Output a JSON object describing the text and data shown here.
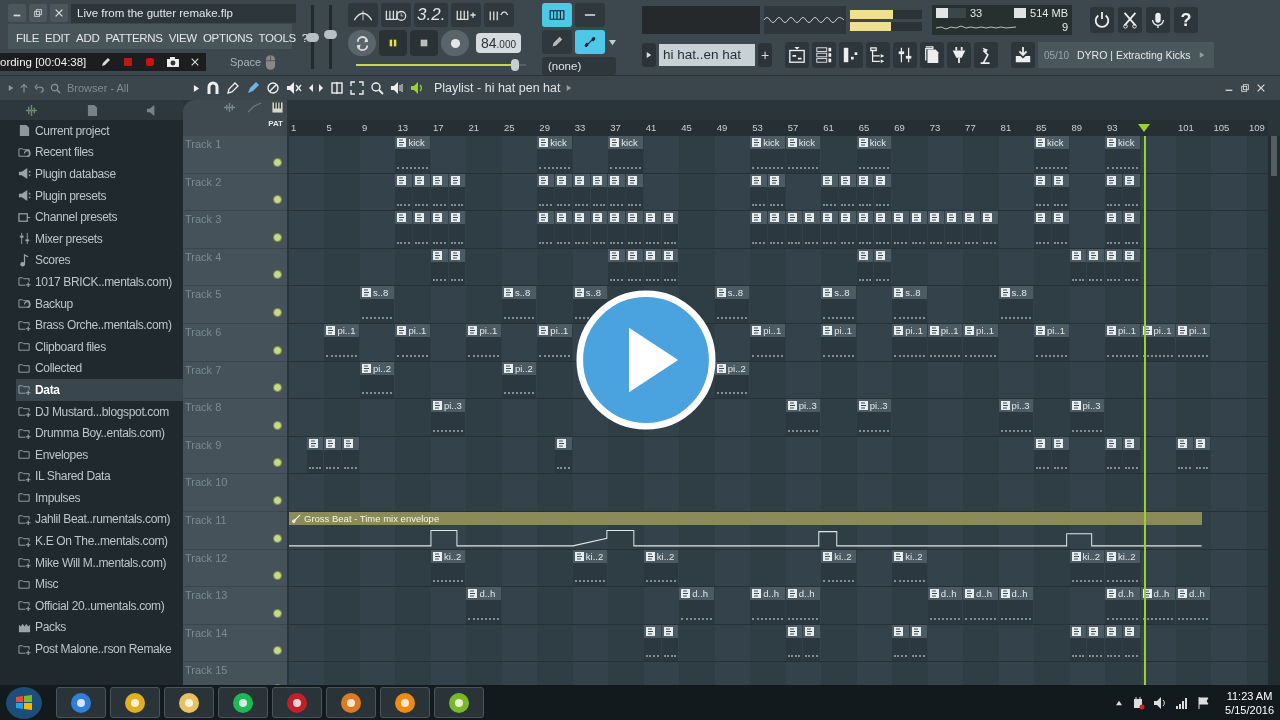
{
  "window": {
    "title": "Live from the gutter remake.flp"
  },
  "menu": [
    "FILE",
    "EDIT",
    "ADD",
    "PATTERNS",
    "VIEW",
    "OPTIONS",
    "TOOLS",
    "?"
  ],
  "recorder": {
    "label": "ording [00:04:38]"
  },
  "hint_key": "Space",
  "mixer_sliders": [
    {
      "level": 0.5
    },
    {
      "level": 0.55
    }
  ],
  "transport": {
    "time_mode": "3.2.",
    "tempo": "84",
    "tempo_fraction": ".000",
    "pitch": {
      "level": 0.96
    },
    "snap": "(none)"
  },
  "meters": [
    {
      "level": 0.6
    },
    {
      "level": 0.57
    }
  ],
  "performance": {
    "cpu": "33",
    "cpu_bar": {
      "level": 0.4
    },
    "ram": "514 MB",
    "polyphony": "9"
  },
  "help_button": "?",
  "pattern_selector": {
    "value": "hi hat..en hat",
    "add": "+"
  },
  "hint_bar": {
    "counter": "05/10",
    "text": "DYRO | Extracting Kicks"
  },
  "browser": {
    "title": "Browser - All",
    "items": [
      {
        "label": "Current project",
        "kind": "project",
        "selected": false
      },
      {
        "label": "Recent files",
        "kind": "recent",
        "selected": false
      },
      {
        "label": "Plugin database",
        "kind": "plugin",
        "selected": false
      },
      {
        "label": "Plugin presets",
        "kind": "plugin",
        "selected": false
      },
      {
        "label": "Channel presets",
        "kind": "channel",
        "selected": false
      },
      {
        "label": "Mixer presets",
        "kind": "mixer",
        "selected": false
      },
      {
        "label": "Scores",
        "kind": "score",
        "selected": false
      },
      {
        "label": "1017 BRICK..mentals.com)",
        "kind": "linked",
        "selected": false
      },
      {
        "label": "Backup",
        "kind": "recent",
        "selected": false
      },
      {
        "label": "Brass Orche..mentals.com)",
        "kind": "linked",
        "selected": false
      },
      {
        "label": "Clipboard files",
        "kind": "folder",
        "selected": false
      },
      {
        "label": "Collected",
        "kind": "folder",
        "selected": false
      },
      {
        "label": "Data",
        "kind": "linked",
        "selected": true
      },
      {
        "label": "DJ Mustard...blogspot.com",
        "kind": "linked",
        "selected": false
      },
      {
        "label": "Drumma Boy..entals.com)",
        "kind": "linked",
        "selected": false
      },
      {
        "label": "Envelopes",
        "kind": "folder",
        "selected": false
      },
      {
        "label": "IL Shared Data",
        "kind": "linked",
        "selected": false
      },
      {
        "label": "Impulses",
        "kind": "folder",
        "selected": false
      },
      {
        "label": "Jahlil Beat..rumentals.com)",
        "kind": "linked",
        "selected": false
      },
      {
        "label": "K.E On The..mentals.com)",
        "kind": "linked",
        "selected": false
      },
      {
        "label": "Mike Will M..mentals.com)",
        "kind": "linked",
        "selected": false
      },
      {
        "label": "Misc",
        "kind": "folder",
        "selected": false
      },
      {
        "label": "Official 20..umentals.com)",
        "kind": "linked",
        "selected": false
      },
      {
        "label": "Packs",
        "kind": "packs",
        "selected": false
      },
      {
        "label": "Post Malone..rson Remake",
        "kind": "linked",
        "selected": false
      }
    ]
  },
  "playlist": {
    "title": "Playlist - hi hat pen hat",
    "mode": "PAT",
    "playhead": {
      "level": 0.873
    },
    "ruler": [
      "1",
      "5",
      "9",
      "13",
      "17",
      "21",
      "25",
      "29",
      "33",
      "37",
      "41",
      "45",
      "49",
      "53",
      "57",
      "61",
      "65",
      "69",
      "73",
      "77",
      "81",
      "85",
      "89",
      "93",
      "101",
      "105",
      "109"
    ],
    "tracks": [
      {
        "name": "Track 1",
        "clips": [
          {
            "kind": "pattern",
            "label": "kick"
          },
          {
            "kind": "pattern",
            "label": "kick"
          },
          {
            "kind": "pattern",
            "label": "kick"
          },
          {
            "kind": "pattern",
            "label": "kick"
          },
          {
            "kind": "pattern",
            "label": "kick"
          },
          {
            "kind": "pattern",
            "label": "kick"
          },
          {
            "kind": "pattern",
            "label": "kick"
          },
          {
            "kind": "pattern",
            "label": "kick"
          }
        ]
      },
      {
        "name": "Track 2",
        "clips": [
          {
            "kind": "pattern"
          },
          {
            "kind": "pattern"
          },
          {
            "kind": "pattern"
          },
          {
            "kind": "pattern"
          },
          {
            "kind": "pattern"
          },
          {
            "kind": "pattern"
          },
          {
            "kind": "pattern"
          },
          {
            "kind": "pattern"
          },
          {
            "kind": "pattern"
          },
          {
            "kind": "pattern"
          },
          {
            "kind": "pattern"
          },
          {
            "kind": "pattern"
          },
          {
            "kind": "pattern"
          },
          {
            "kind": "pattern"
          },
          {
            "kind": "pattern"
          },
          {
            "kind": "pattern"
          },
          {
            "kind": "pattern"
          },
          {
            "kind": "pattern"
          },
          {
            "kind": "pattern"
          },
          {
            "kind": "pattern"
          }
        ]
      },
      {
        "name": "Track 3",
        "clips": [
          {
            "kind": "pattern"
          },
          {
            "kind": "pattern"
          },
          {
            "kind": "pattern"
          },
          {
            "kind": "pattern"
          },
          {
            "kind": "pattern"
          },
          {
            "kind": "pattern"
          },
          {
            "kind": "pattern"
          },
          {
            "kind": "pattern"
          },
          {
            "kind": "pattern"
          },
          {
            "kind": "pattern"
          },
          {
            "kind": "pattern"
          },
          {
            "kind": "pattern"
          },
          {
            "kind": "pattern"
          },
          {
            "kind": "pattern"
          },
          {
            "kind": "pattern"
          },
          {
            "kind": "pattern"
          },
          {
            "kind": "pattern"
          },
          {
            "kind": "pattern"
          },
          {
            "kind": "pattern"
          },
          {
            "kind": "pattern"
          },
          {
            "kind": "pattern"
          },
          {
            "kind": "pattern"
          },
          {
            "kind": "pattern"
          },
          {
            "kind": "pattern"
          },
          {
            "kind": "pattern"
          },
          {
            "kind": "pattern"
          },
          {
            "kind": "pattern"
          },
          {
            "kind": "pattern"
          },
          {
            "kind": "pattern"
          },
          {
            "kind": "pattern"
          }
        ]
      },
      {
        "name": "Track 4",
        "clips": [
          {
            "kind": "pattern"
          },
          {
            "kind": "pattern"
          },
          {
            "kind": "pattern"
          },
          {
            "kind": "pattern"
          },
          {
            "kind": "pattern"
          },
          {
            "kind": "pattern"
          },
          {
            "kind": "pattern"
          },
          {
            "kind": "pattern"
          },
          {
            "kind": "pattern"
          },
          {
            "kind": "pattern"
          },
          {
            "kind": "pattern"
          },
          {
            "kind": "pattern"
          }
        ]
      },
      {
        "name": "Track 5",
        "clips": [
          {
            "kind": "pattern",
            "label": "s..8"
          },
          {
            "kind": "pattern",
            "label": "s..8"
          },
          {
            "kind": "pattern",
            "label": "s..8"
          },
          {
            "kind": "pattern",
            "label": "s..8"
          },
          {
            "kind": "pattern",
            "label": "s..8"
          },
          {
            "kind": "pattern",
            "label": "s..8"
          },
          {
            "kind": "pattern",
            "label": "s..8"
          }
        ]
      },
      {
        "name": "Track 6",
        "clips": [
          {
            "kind": "pattern",
            "label": "pi..1"
          },
          {
            "kind": "pattern",
            "label": "pi..1"
          },
          {
            "kind": "pattern",
            "label": "pi..1"
          },
          {
            "kind": "pattern",
            "label": "pi..1"
          },
          {
            "kind": "pattern",
            "label": "pi..1"
          },
          {
            "kind": "pattern",
            "label": "pi..1"
          },
          {
            "kind": "pattern",
            "label": "pi..1"
          },
          {
            "kind": "pattern",
            "label": "pi..1"
          },
          {
            "kind": "pattern",
            "label": "pi..1"
          },
          {
            "kind": "pattern",
            "label": "pi..1"
          },
          {
            "kind": "pattern",
            "label": "pi..1"
          },
          {
            "kind": "pattern",
            "label": "pi..1"
          },
          {
            "kind": "pattern",
            "label": "pi..1"
          }
        ]
      },
      {
        "name": "Track 7",
        "clips": [
          {
            "kind": "pattern",
            "label": "pi..2"
          },
          {
            "kind": "pattern",
            "label": "pi..2"
          },
          {
            "kind": "pattern",
            "label": "pi..2"
          }
        ]
      },
      {
        "name": "Track 8",
        "clips": [
          {
            "kind": "pattern",
            "label": "pi..3"
          },
          {
            "kind": "pattern",
            "label": "pi..3"
          },
          {
            "kind": "pattern",
            "label": "pi..3"
          },
          {
            "kind": "pattern",
            "label": "pi..3"
          },
          {
            "kind": "pattern",
            "label": "pi..3"
          }
        ]
      },
      {
        "name": "Track 9",
        "clips": [
          {
            "kind": "pattern"
          },
          {
            "kind": "pattern"
          },
          {
            "kind": "pattern"
          },
          {
            "kind": "pattern"
          },
          {
            "kind": "pattern"
          },
          {
            "kind": "pattern"
          },
          {
            "kind": "pattern"
          },
          {
            "kind": "pattern"
          },
          {
            "kind": "pattern"
          },
          {
            "kind": "pattern"
          }
        ]
      },
      {
        "name": "Track 10"
      },
      {
        "name": "Track 11",
        "clips": [
          {
            "kind": "automation",
            "label": "Gross Beat - Time mix envelope"
          }
        ]
      },
      {
        "name": "Track 12",
        "clips": [
          {
            "kind": "pattern",
            "label": "ki..2"
          },
          {
            "kind": "pattern",
            "label": "ki..2"
          },
          {
            "kind": "pattern",
            "label": "ki..2"
          },
          {
            "kind": "pattern",
            "label": "ki..2"
          },
          {
            "kind": "pattern",
            "label": "ki..2"
          },
          {
            "kind": "pattern",
            "label": "ki..2"
          },
          {
            "kind": "pattern",
            "label": "ki..2"
          }
        ]
      },
      {
        "name": "Track 13",
        "clips": [
          {
            "kind": "pattern",
            "label": "d..h"
          },
          {
            "kind": "pattern",
            "label": "d..h"
          },
          {
            "kind": "pattern",
            "label": "d..h"
          },
          {
            "kind": "pattern",
            "label": "d..h"
          },
          {
            "kind": "pattern",
            "label": "d..h"
          },
          {
            "kind": "pattern",
            "label": "d..h"
          },
          {
            "kind": "pattern",
            "label": "d..h"
          },
          {
            "kind": "pattern",
            "label": "d..h"
          },
          {
            "kind": "pattern",
            "label": "d..h"
          },
          {
            "kind": "pattern",
            "label": "d..h"
          }
        ]
      },
      {
        "name": "Track 14",
        "clips": [
          {
            "kind": "pattern"
          },
          {
            "kind": "pattern"
          },
          {
            "kind": "pattern"
          },
          {
            "kind": "pattern"
          },
          {
            "kind": "pattern"
          },
          {
            "kind": "pattern"
          },
          {
            "kind": "pattern"
          },
          {
            "kind": "pattern"
          },
          {
            "kind": "pattern"
          },
          {
            "kind": "pattern"
          }
        ]
      },
      {
        "name": "Track 15"
      }
    ]
  },
  "clock": {
    "time": "11:23 AM",
    "date": "5/15/2016"
  }
}
